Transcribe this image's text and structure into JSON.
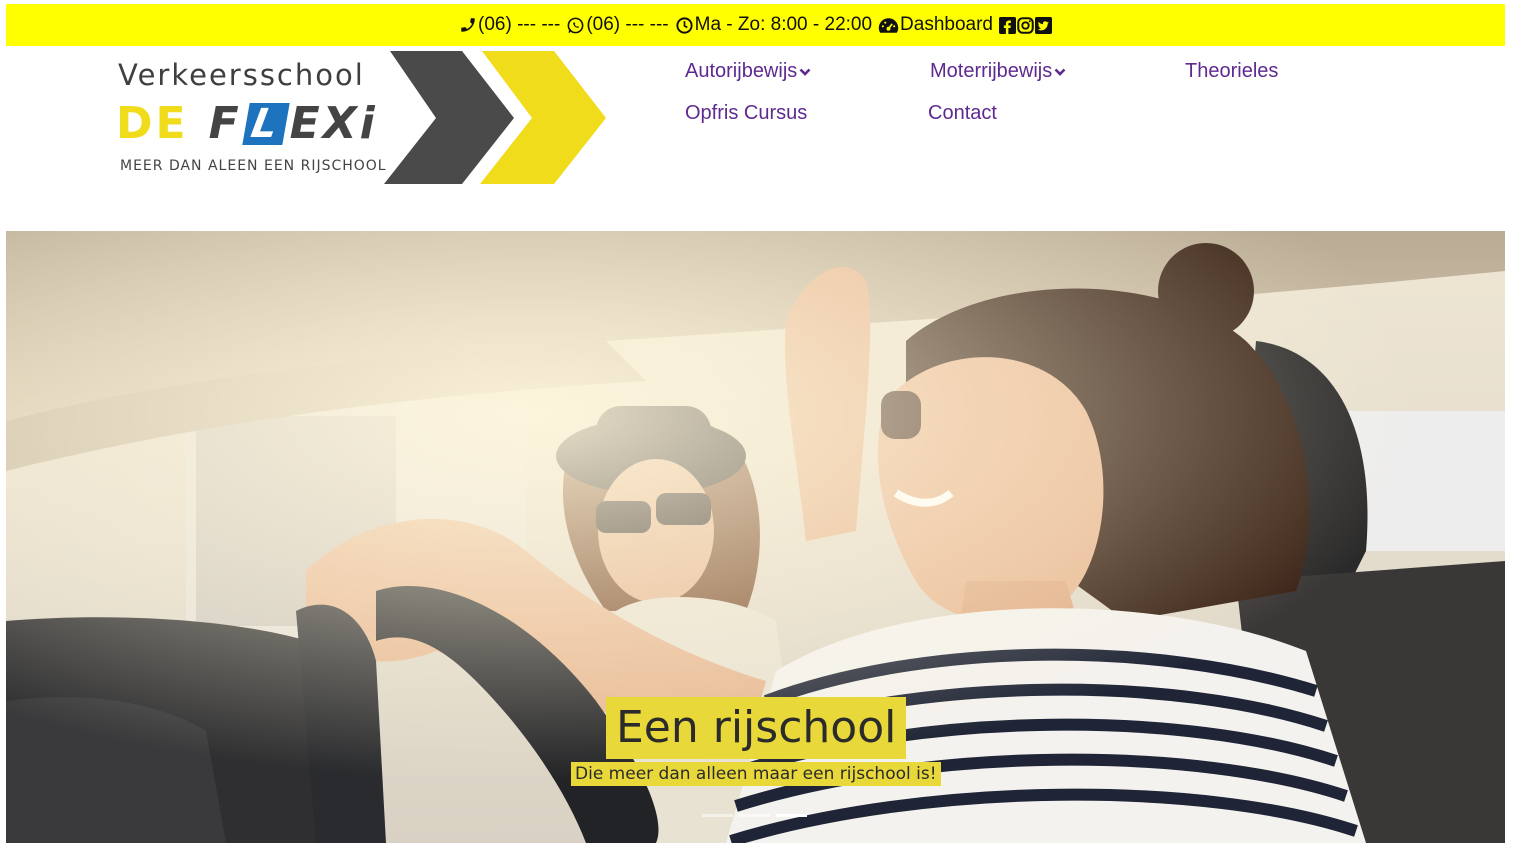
{
  "topbar": {
    "phone": "(06) --- ---",
    "whatsapp": "(06) --- ---",
    "hours": "Ma - Zo: 8:00 - 22:00",
    "dashboard": "Dashboard",
    "background": "#ffff00",
    "icons": [
      "phone-icon",
      "whatsapp-icon",
      "clock-icon",
      "dashboard-icon",
      "facebook-icon",
      "instagram-icon",
      "twitter-icon"
    ]
  },
  "logo": {
    "line1": "Verkeersschool",
    "de": "DE",
    "f": "F",
    "l": "L",
    "exi": "EXi",
    "tagline": "MEER DAN ALEEN EEN RIJSCHOOL",
    "colors": {
      "yellow": "#f0dc1a",
      "gray": "#4a4a4a",
      "blue": "#1e73be"
    }
  },
  "nav": {
    "items": [
      {
        "label": "Autorijbewijs",
        "dropdown": true
      },
      {
        "label": "Moterrijbewijs",
        "dropdown": true
      },
      {
        "label": "Theorieles",
        "dropdown": false
      },
      {
        "label": "Opfris Cursus",
        "dropdown": false
      },
      {
        "label": "Contact",
        "dropdown": false
      }
    ],
    "color": "#5e2a90"
  },
  "hero": {
    "title": "Een rijschool",
    "subtitle": "Die meer dan alleen maar een rijschool is!",
    "caption_bg": "#e8d83a",
    "slides_count": 3,
    "active_slide": 3
  }
}
